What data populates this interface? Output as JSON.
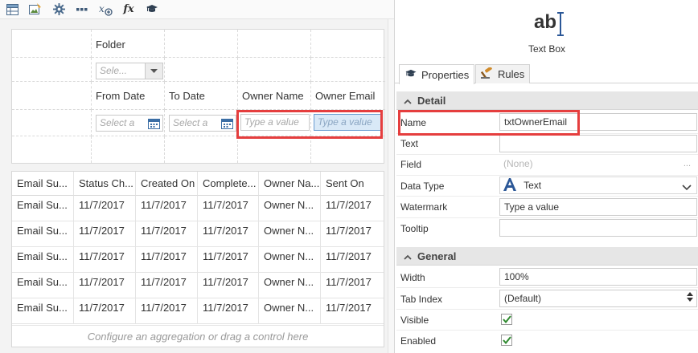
{
  "toolbar": {
    "icons": [
      "grid-icon",
      "image-edit-icon",
      "gear-icon",
      "more-icon",
      "variable-icon",
      "function-icon",
      "graduation-cap-icon"
    ],
    "fx_label": "fx"
  },
  "filter_form": {
    "folder_label": "Folder",
    "folder_placeholder": "Sele...",
    "from_date_label": "From Date",
    "from_date_placeholder": "Select a",
    "to_date_label": "To Date",
    "to_date_placeholder": "Select a",
    "owner_name_label": "Owner Name",
    "owner_name_placeholder": "Type a value",
    "owner_email_label": "Owner Email",
    "owner_email_placeholder": "Type a value"
  },
  "list": {
    "columns": [
      "Email Su...",
      "Status Ch...",
      "Created On",
      "Complete...",
      "Owner Na...",
      "Sent On"
    ],
    "rows": [
      [
        "Email Su...",
        "11/7/2017",
        "11/7/2017",
        "11/7/2017",
        "Owner N...",
        "11/7/2017"
      ],
      [
        "Email Su...",
        "11/7/2017",
        "11/7/2017",
        "11/7/2017",
        "Owner N...",
        "11/7/2017"
      ],
      [
        "Email Su...",
        "11/7/2017",
        "11/7/2017",
        "11/7/2017",
        "Owner N...",
        "11/7/2017"
      ],
      [
        "Email Su...",
        "11/7/2017",
        "11/7/2017",
        "11/7/2017",
        "Owner N...",
        "11/7/2017"
      ],
      [
        "Email Su...",
        "11/7/2017",
        "11/7/2017",
        "11/7/2017",
        "Owner N...",
        "11/7/2017"
      ]
    ],
    "aggregation_hint": "Configure an aggregation or drag a control here"
  },
  "properties": {
    "control_icon_text": "ab",
    "control_type": "Text Box",
    "tabs": [
      {
        "label": "Properties",
        "icon": "graduation-cap-icon",
        "active": true
      },
      {
        "label": "Rules",
        "icon": "gavel-icon",
        "active": false
      }
    ],
    "detail": {
      "title": "Detail",
      "name_label": "Name",
      "name_value": "txtOwnerEmail",
      "text_label": "Text",
      "text_value": "",
      "field_label": "Field",
      "field_value": "(None)",
      "field_more": "...",
      "data_type_label": "Data Type",
      "data_type_value": "Text",
      "watermark_label": "Watermark",
      "watermark_value": "Type a value",
      "tooltip_label": "Tooltip",
      "tooltip_value": ""
    },
    "general": {
      "title": "General",
      "width_label": "Width",
      "width_value": "100%",
      "tab_index_label": "Tab Index",
      "tab_index_value": "(Default)",
      "visible_label": "Visible",
      "visible_checked": true,
      "enabled_label": "Enabled",
      "enabled_checked": true
    }
  },
  "colors": {
    "highlight": "#e53e3e",
    "selected_field_bg": "#d9e9f7",
    "checkmark": "#2f8a2f",
    "text_type_glyph": "#2b5797"
  }
}
